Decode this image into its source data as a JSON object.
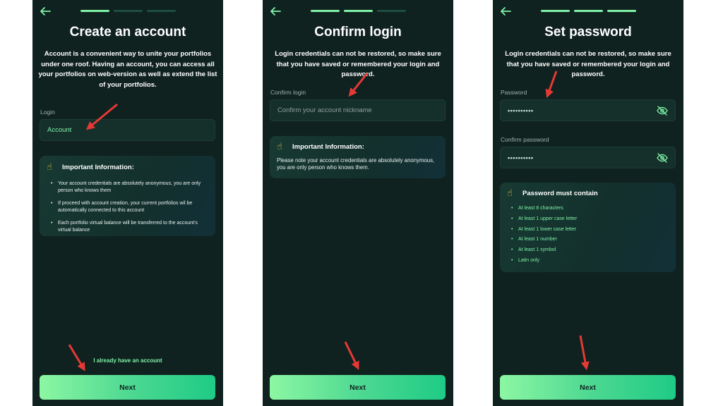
{
  "screens": [
    {
      "title": "Create an account",
      "description": "Account is a convenient way to unite your portfolios under one roof. Having an account,  you can access all your portfolios on web-version as well as extend the list of your portfolios.",
      "login_label": "Login",
      "login_value": "Account",
      "info_title": "Important Information:",
      "info_items": [
        "Your account credentials are absolutely anonymous, you are only person who knows them",
        "If proceed with account creation, your current portfolios wil be automatically connected to this account",
        "Each portfolio virtual balance will be transferred to the account's virtual balance"
      ],
      "link": "I already have an account",
      "next_label": "Next",
      "active_steps": 1
    },
    {
      "title": "Confirm login",
      "description": "Login credentials can not be restored, so make sure that you have saved or remembered your login and password.",
      "confirm_label": "Confirm login",
      "confirm_placeholder": "Confirm your account nickname",
      "info_title": "Important Information:",
      "info_text": "Please note your account credentials are absolutely anonymous, you are only person who knows them.",
      "next_label": "Next",
      "active_steps": 2
    },
    {
      "title": "Set password",
      "description": "Login credentials can not be restored, so make sure that you have saved or remembered your login and password.",
      "password_label": "Password",
      "password_value": "••••••••••",
      "confirm_password_label": "Confirm password",
      "confirm_password_value": "••••••••••",
      "rules_title": "Password must contain",
      "rules": [
        "At least 8 characters",
        "At least 1 upper case letter",
        "At least 1 lower case letter",
        "At least 1 number",
        "At least 1 symbol",
        "Latin only"
      ],
      "next_label": "Next",
      "active_steps": 3
    }
  ],
  "icons": {
    "back": "arrow-left-icon",
    "hand": "pointing-up-hand-icon",
    "eye": "eye-slash-icon",
    "annotation": "red-arrow-icon"
  },
  "colors": {
    "background": "#102220",
    "accent": "#7ef2a7",
    "annotation": "#e53935",
    "button_gradient_start": "#8cf7a3",
    "button_gradient_end": "#1ecb86"
  }
}
